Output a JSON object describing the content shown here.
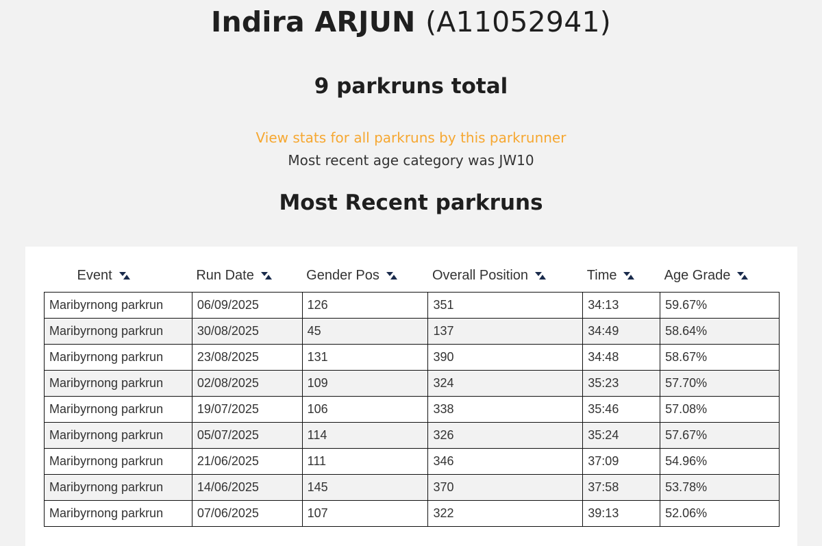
{
  "runner": {
    "first_name": "Indira",
    "last_name": "ARJUN",
    "id": "(A11052941)"
  },
  "summary": {
    "total": "9 parkruns total",
    "stats_link": "View stats for all parkruns by this parkrunner",
    "age_category": "Most recent age category was JW10"
  },
  "recent": {
    "title": "Most Recent parkruns",
    "columns": [
      "Event",
      "Run Date",
      "Gender Pos",
      "Overall Position",
      "Time",
      "Age Grade"
    ],
    "rows": [
      [
        "Maribyrnong parkrun",
        "06/09/2025",
        "126",
        "351",
        "34:13",
        "59.67%"
      ],
      [
        "Maribyrnong parkrun",
        "30/08/2025",
        "45",
        "137",
        "34:49",
        "58.64%"
      ],
      [
        "Maribyrnong parkrun",
        "23/08/2025",
        "131",
        "390",
        "34:48",
        "58.67%"
      ],
      [
        "Maribyrnong parkrun",
        "02/08/2025",
        "109",
        "324",
        "35:23",
        "57.70%"
      ],
      [
        "Maribyrnong parkrun",
        "19/07/2025",
        "106",
        "338",
        "35:46",
        "57.08%"
      ],
      [
        "Maribyrnong parkrun",
        "05/07/2025",
        "114",
        "326",
        "35:24",
        "57.67%"
      ],
      [
        "Maribyrnong parkrun",
        "21/06/2025",
        "111",
        "346",
        "37:09",
        "54.96%"
      ],
      [
        "Maribyrnong parkrun",
        "14/06/2025",
        "145",
        "370",
        "37:58",
        "53.78%"
      ],
      [
        "Maribyrnong parkrun",
        "07/06/2025",
        "107",
        "322",
        "39:13",
        "52.06%"
      ]
    ]
  },
  "colors": {
    "link": "#f6a730",
    "sort_icon": "#1a2b4c",
    "background": "#f2f2f2"
  }
}
